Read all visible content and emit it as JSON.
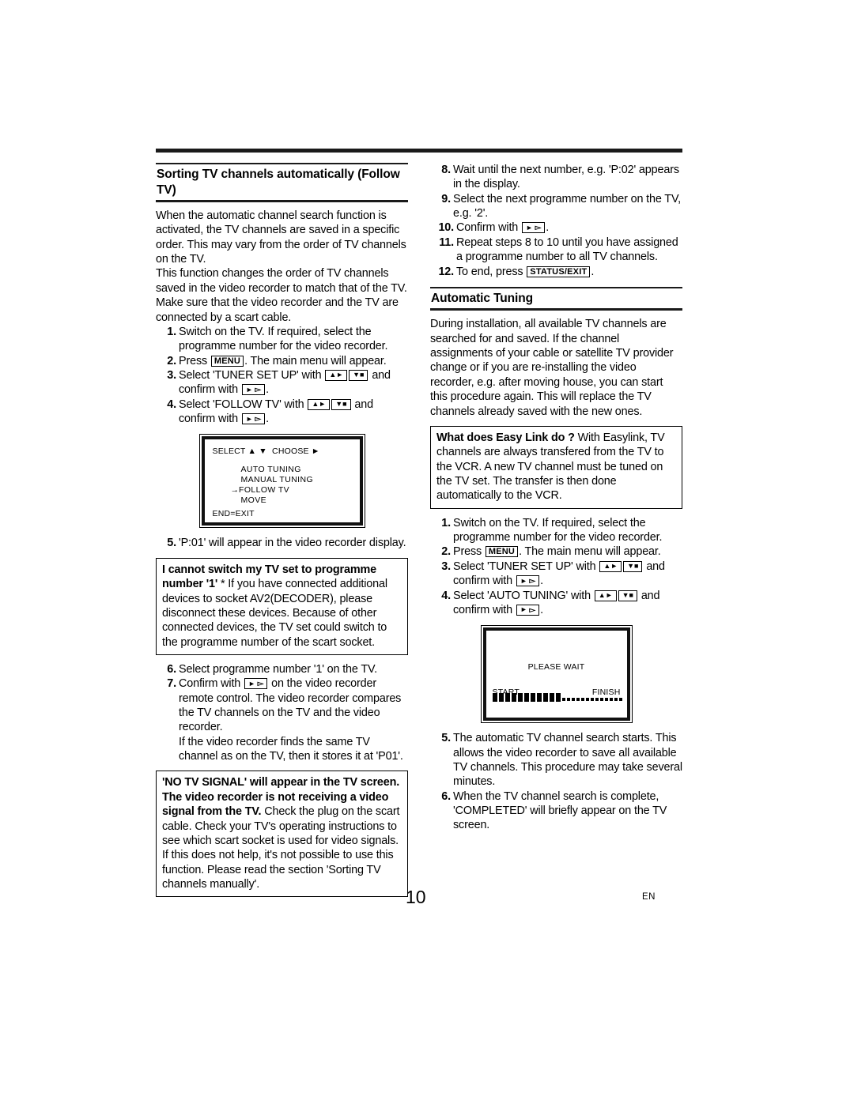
{
  "document": {
    "page_number": "10",
    "language_code": "EN"
  },
  "left_column": {
    "heading": "Sorting TV channels automatically (Follow TV)",
    "intro_paragraphs": [
      "When the automatic channel search function is activated, the TV channels are saved in a specific order. This may vary from the order of TV channels on the TV.",
      "This function changes the order of TV channels saved in the video recorder to match that of the TV.",
      "Make sure that the video recorder and the TV are connected by a scart cable."
    ],
    "steps": [
      {
        "num": "1.",
        "pre": "Switch on the TV. If required, select the programme number for the video recorder.",
        "post": ""
      },
      {
        "num": "2.",
        "pre": "Press ",
        "key": "MENU",
        "post": ". The main menu will appear."
      },
      {
        "num": "3.",
        "pre": "Select 'TUNER SET UP' with ",
        "post": " and confirm with "
      },
      {
        "num": "4.",
        "pre": "Select 'FOLLOW TV' with ",
        "post": " and confirm with "
      },
      {
        "num": "5.",
        "pre": "'P:01' will appear in the video recorder display.",
        "post": ""
      },
      {
        "num": "6.",
        "pre": "Select programme number '1' on the TV.",
        "post": ""
      },
      {
        "num": "7.",
        "pre": "Confirm with ",
        "post": " on the video recorder remote control. The video recorder compares the TV channels on the TV and the video recorder."
      }
    ],
    "step7_continuation": "If the video recorder finds the same TV channel as on the TV, then it stores it at 'P01'.",
    "osd_menu": {
      "header_left": "SELECT",
      "header_right": "CHOOSE",
      "items": [
        "AUTO TUNING",
        "MANUAL TUNING",
        "FOLLOW TV",
        "MOVE"
      ],
      "selected_item": "FOLLOW TV",
      "footer": "END=EXIT"
    },
    "note_box_1": {
      "title": "I cannot switch my TV set to programme number '1'",
      "body": "* If you have connected additional devices to socket AV2(DECODER), please disconnect these devices. Because of other connected devices, the TV set could switch to the programme number of the scart socket."
    },
    "note_box_2": {
      "title": "'NO TV SIGNAL' will appear in the TV screen. The video recorder is not receiving a video signal from the TV.",
      "body_lines": [
        "Check the plug on the scart cable.",
        "Check your TV's operating instructions to see which scart socket is used for video signals.",
        "If this does not help, it's not possible to use this function. Please read the section 'Sorting TV channels manually'."
      ]
    }
  },
  "right_column": {
    "continued_steps": [
      {
        "num": "8.",
        "pre": "Wait until the next number, e.g. 'P:02' appears in the display.",
        "post": ""
      },
      {
        "num": "9.",
        "pre": "Select the next programme number on the TV, e.g. '2'.",
        "post": ""
      },
      {
        "num": "10.",
        "pre": "Confirm with ",
        "post": "."
      },
      {
        "num": "11.",
        "pre": "Repeat steps 8 to 10 until you have assigned a programme number to all TV channels.",
        "post": ""
      },
      {
        "num": "12.",
        "pre": "To end, press ",
        "key": "STATUS/EXIT",
        "post": "."
      }
    ],
    "heading": "Automatic Tuning",
    "intro_paragraph": "During installation, all available TV channels are searched for and saved. If the channel assignments of your cable or satellite TV provider change or if you are re-installing the video recorder, e.g. after moving house, you can start this procedure again. This will replace the TV channels already saved with the new ones.",
    "note_box": {
      "title": "What does Easy Link do ?",
      "body": "With Easylink, TV channels are always transfered from the TV to the VCR. A new TV channel must be tuned on the TV set. The transfer is then done automatically to the VCR."
    },
    "steps": [
      {
        "num": "1.",
        "pre": "Switch on the TV. If required, select the programme number for the video recorder.",
        "post": ""
      },
      {
        "num": "2.",
        "pre": "Press ",
        "key": "MENU",
        "post": ". The main menu will appear."
      },
      {
        "num": "3.",
        "pre": "Select 'TUNER SET UP' with ",
        "post": " and confirm with "
      },
      {
        "num": "4.",
        "pre": "Select 'AUTO TUNING' with ",
        "post": " and confirm with "
      },
      {
        "num": "5.",
        "pre": "The automatic TV channel search starts. This allows the video recorder to save all available TV channels. This procedure may take several minutes.",
        "post": ""
      },
      {
        "num": "6.",
        "pre": "When the TV channel search is complete, 'COMPLETED' will briefly appear on the TV screen.",
        "post": ""
      }
    ],
    "osd_wait": {
      "message": "PLEASE WAIT",
      "start_label": "START",
      "finish_label": "FINISH",
      "progress_filled_blocks": 11,
      "progress_remaining_dots": 13
    }
  },
  "keys": {
    "menu": "MENU",
    "status_exit": "STATUS/EXIT",
    "up_right": "▲►",
    "down_stop": "▼■",
    "play_confirm": "► ▻"
  }
}
